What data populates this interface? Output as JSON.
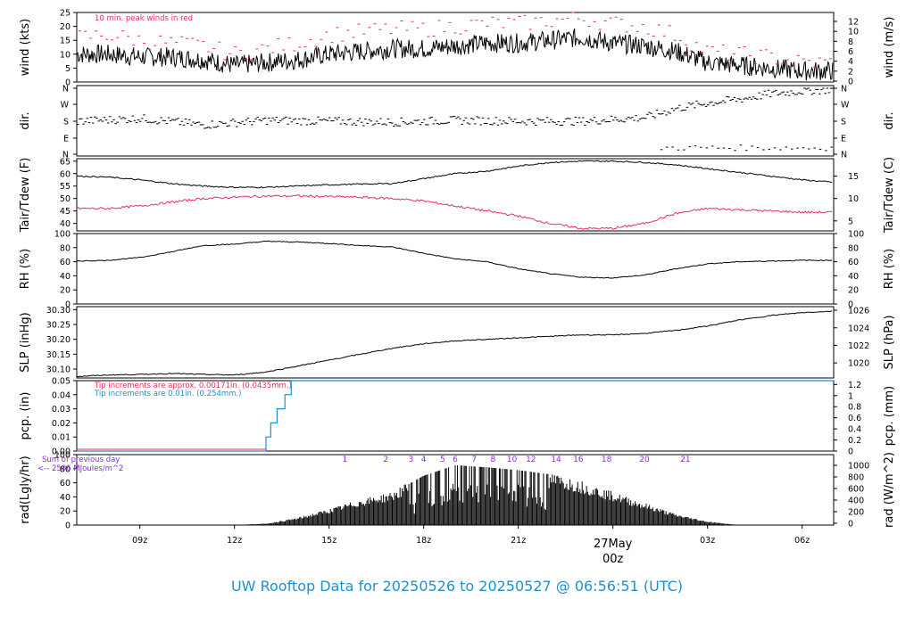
{
  "title": "UW Rooftop Data for 20250526  to  20250527 @ 06:56:51  (UTC)",
  "colors": {
    "accent_red": "#e8315a",
    "accent_blue": "#1f8fd0",
    "accent_purple": "#8b2be2",
    "line": "#000000"
  },
  "x_axis": {
    "ticks": [
      {
        "label": "09z",
        "hour": 9
      },
      {
        "label": "12z",
        "hour": 12
      },
      {
        "label": "15z",
        "hour": 15
      },
      {
        "label": "18z",
        "hour": 18
      },
      {
        "label": "21z",
        "hour": 21
      },
      {
        "label": "03z",
        "hour": 27
      },
      {
        "label": "06z",
        "hour": 30
      }
    ],
    "day_label": "27May",
    "day_time_label": "00z",
    "range_hours": [
      7.0,
      31.0
    ]
  },
  "chart_data": [
    {
      "type": "line",
      "id": "wind",
      "ylabel": "wind (kts)",
      "ylabel_right": "wind (m/s)",
      "ylim": [
        0,
        25
      ],
      "yticks": [
        "0",
        "5",
        "10",
        "15",
        "20",
        "25"
      ],
      "right_ticks": [
        "0",
        "2",
        "4",
        "6",
        "8",
        "10",
        "12"
      ],
      "annotation": "10 min. peak winds in red",
      "series": [
        {
          "name": "wind",
          "x": [
            7,
            8,
            9,
            10,
            11,
            12,
            13,
            14,
            15,
            16,
            17,
            18,
            19,
            20,
            21,
            22,
            23,
            24,
            25,
            26,
            27,
            28,
            29,
            30,
            31
          ],
          "y": [
            10,
            10,
            9,
            9,
            8,
            6,
            7,
            8,
            10,
            11,
            12,
            12,
            13,
            14,
            14,
            15,
            16,
            14,
            13,
            11,
            7,
            6,
            5,
            4,
            4
          ]
        },
        {
          "name": "10 min. peak",
          "x": [
            7,
            8,
            9,
            10,
            11,
            12,
            13,
            14,
            15,
            16,
            17,
            18,
            19,
            20,
            21,
            22,
            23,
            24,
            25,
            26,
            27,
            28,
            29,
            30,
            31
          ],
          "y": [
            16,
            17,
            15,
            14,
            13,
            10,
            12,
            14,
            17,
            18,
            19,
            19,
            20,
            21,
            21,
            22,
            23,
            21,
            20,
            17,
            11,
            10,
            9,
            7,
            7
          ]
        }
      ]
    },
    {
      "type": "scatter",
      "id": "dir",
      "ylabel": "dir.",
      "ylabel_right": "dir.",
      "yticks": [
        "N",
        "E",
        "S",
        "W",
        "N"
      ],
      "series": [
        {
          "name": "direction",
          "x": [
            7,
            9,
            11,
            13,
            15,
            17,
            19,
            21,
            23,
            25,
            26,
            27,
            28,
            29,
            30,
            31
          ],
          "y": [
            180,
            195,
            160,
            185,
            180,
            175,
            185,
            180,
            180,
            200,
            250,
            280,
            300,
            330,
            345,
            355
          ]
        }
      ]
    },
    {
      "type": "line",
      "id": "temp",
      "ylabel": "Tair/Tdew (F)",
      "ylabel_right": "Tair/Tdew (C)",
      "ylim": [
        37,
        66
      ],
      "yticks": [
        "40",
        "45",
        "50",
        "55",
        "60",
        "65"
      ],
      "right_ticks": [
        "5",
        "10",
        "15"
      ],
      "series": [
        {
          "name": "Tair",
          "x": [
            7,
            8,
            9,
            10,
            11,
            12,
            13,
            14,
            15,
            16,
            17,
            18,
            19,
            20,
            21,
            22,
            23,
            24,
            25,
            26,
            27,
            28,
            29,
            30,
            31
          ],
          "y": [
            59,
            58.6,
            57.5,
            56,
            55,
            54.5,
            54.5,
            55,
            55.5,
            55.8,
            56,
            58,
            60,
            61,
            63,
            64.5,
            65,
            65,
            64.5,
            63.5,
            62,
            60.5,
            59,
            57.5,
            56.5
          ]
        },
        {
          "name": "Tdew",
          "x": [
            7,
            8,
            9,
            10,
            11,
            12,
            13,
            14,
            15,
            16,
            17,
            18,
            19,
            20,
            21,
            22,
            23,
            24,
            25,
            26,
            27,
            28,
            29,
            30,
            31
          ],
          "y": [
            46,
            46,
            47,
            48.5,
            50,
            50.5,
            51,
            51,
            50.8,
            50.5,
            50,
            49,
            47,
            45,
            43,
            40,
            38,
            38,
            40,
            44,
            46,
            45.5,
            45,
            44.5,
            44.5
          ]
        }
      ]
    },
    {
      "type": "line",
      "id": "rh",
      "ylabel": "RH (%)",
      "ylabel_right": "RH (%)",
      "ylim": [
        0,
        100
      ],
      "yticks": [
        "0",
        "20",
        "40",
        "60",
        "80",
        "100"
      ],
      "series": [
        {
          "name": "RH",
          "x": [
            7,
            8,
            9,
            10,
            11,
            12,
            13,
            14,
            15,
            16,
            17,
            18,
            19,
            20,
            21,
            22,
            23,
            24,
            25,
            26,
            27,
            28,
            29,
            30,
            31
          ],
          "y": [
            61,
            62,
            66,
            74,
            83,
            85,
            89,
            88,
            86,
            83,
            81,
            72,
            64,
            60,
            50,
            43,
            38,
            37,
            41,
            50,
            57,
            60,
            61,
            62,
            62
          ]
        }
      ]
    },
    {
      "type": "line",
      "id": "slp",
      "ylabel": "SLP (inHg)",
      "ylabel_right": "SLP (hPa)",
      "ylim": [
        30.07,
        30.31
      ],
      "yticks": [
        "30.10",
        "30.15",
        "30.20",
        "30.25",
        "30.30"
      ],
      "right_ticks": [
        "1020",
        "1022",
        "1024",
        "1026"
      ],
      "series": [
        {
          "name": "SLP",
          "x": [
            7,
            8,
            9,
            10,
            11,
            12,
            13,
            14,
            15,
            16,
            17,
            18,
            19,
            20,
            21,
            22,
            23,
            24,
            25,
            26,
            27,
            28,
            29,
            30,
            31
          ],
          "y": [
            30.075,
            30.08,
            30.082,
            30.085,
            30.082,
            30.08,
            30.09,
            30.11,
            30.13,
            30.15,
            30.17,
            30.185,
            30.195,
            30.2,
            30.205,
            30.21,
            30.215,
            30.215,
            30.22,
            30.23,
            30.245,
            30.265,
            30.28,
            30.29,
            30.295
          ]
        }
      ]
    },
    {
      "type": "line",
      "id": "pcp",
      "ylabel": "pcp. (in)",
      "ylabel_right": "pcp. (mm)",
      "ylim": [
        0,
        0.05
      ],
      "yticks": [
        "0.00",
        "0.01",
        "0.02",
        "0.03",
        "0.04",
        "0.05"
      ],
      "right_ticks": [
        "0",
        "0.2",
        "0.4",
        "0.6",
        "0.8",
        "1",
        "1.2"
      ],
      "annotations": [
        "Tip increments are approx. 0.00171in. (0.0435mm.)",
        "Tip increments are 0.01in. (0.254mm.)"
      ],
      "series": [
        {
          "name": "pcp",
          "x": [
            7,
            13.0,
            13.0,
            13.15,
            13.15,
            13.35,
            13.35,
            13.6,
            13.6,
            13.8,
            13.8,
            31
          ],
          "y": [
            0,
            0,
            0.01,
            0.01,
            0.02,
            0.02,
            0.03,
            0.03,
            0.04,
            0.04,
            0.05,
            0.05
          ]
        }
      ]
    },
    {
      "type": "bar",
      "id": "rad",
      "ylabel": "rad(Lgly/hr)",
      "ylabel_right": "rad (W/m^2)",
      "ylim": [
        0,
        100
      ],
      "yticks": [
        "0",
        "20",
        "40",
        "60",
        "80",
        "100"
      ],
      "right_ticks": [
        "0",
        "200",
        "400",
        "600",
        "800",
        "1000"
      ],
      "annotations": [
        "Sum of previous day",
        "<-- 2506 MJoules/m^2"
      ],
      "hour_labels": [
        "1",
        "2",
        "3",
        "4",
        "5",
        "6",
        "7",
        "8",
        "10",
        "12",
        "14",
        "16",
        "18",
        "20",
        "21"
      ],
      "envelope": {
        "x": [
          12,
          13,
          14,
          15,
          16,
          17,
          18,
          19,
          20,
          21,
          22,
          23,
          24,
          25,
          26,
          27,
          28
        ],
        "y": [
          0,
          2,
          10,
          22,
          35,
          45,
          70,
          85,
          82,
          78,
          72,
          60,
          45,
          30,
          15,
          5,
          0
        ]
      }
    }
  ]
}
